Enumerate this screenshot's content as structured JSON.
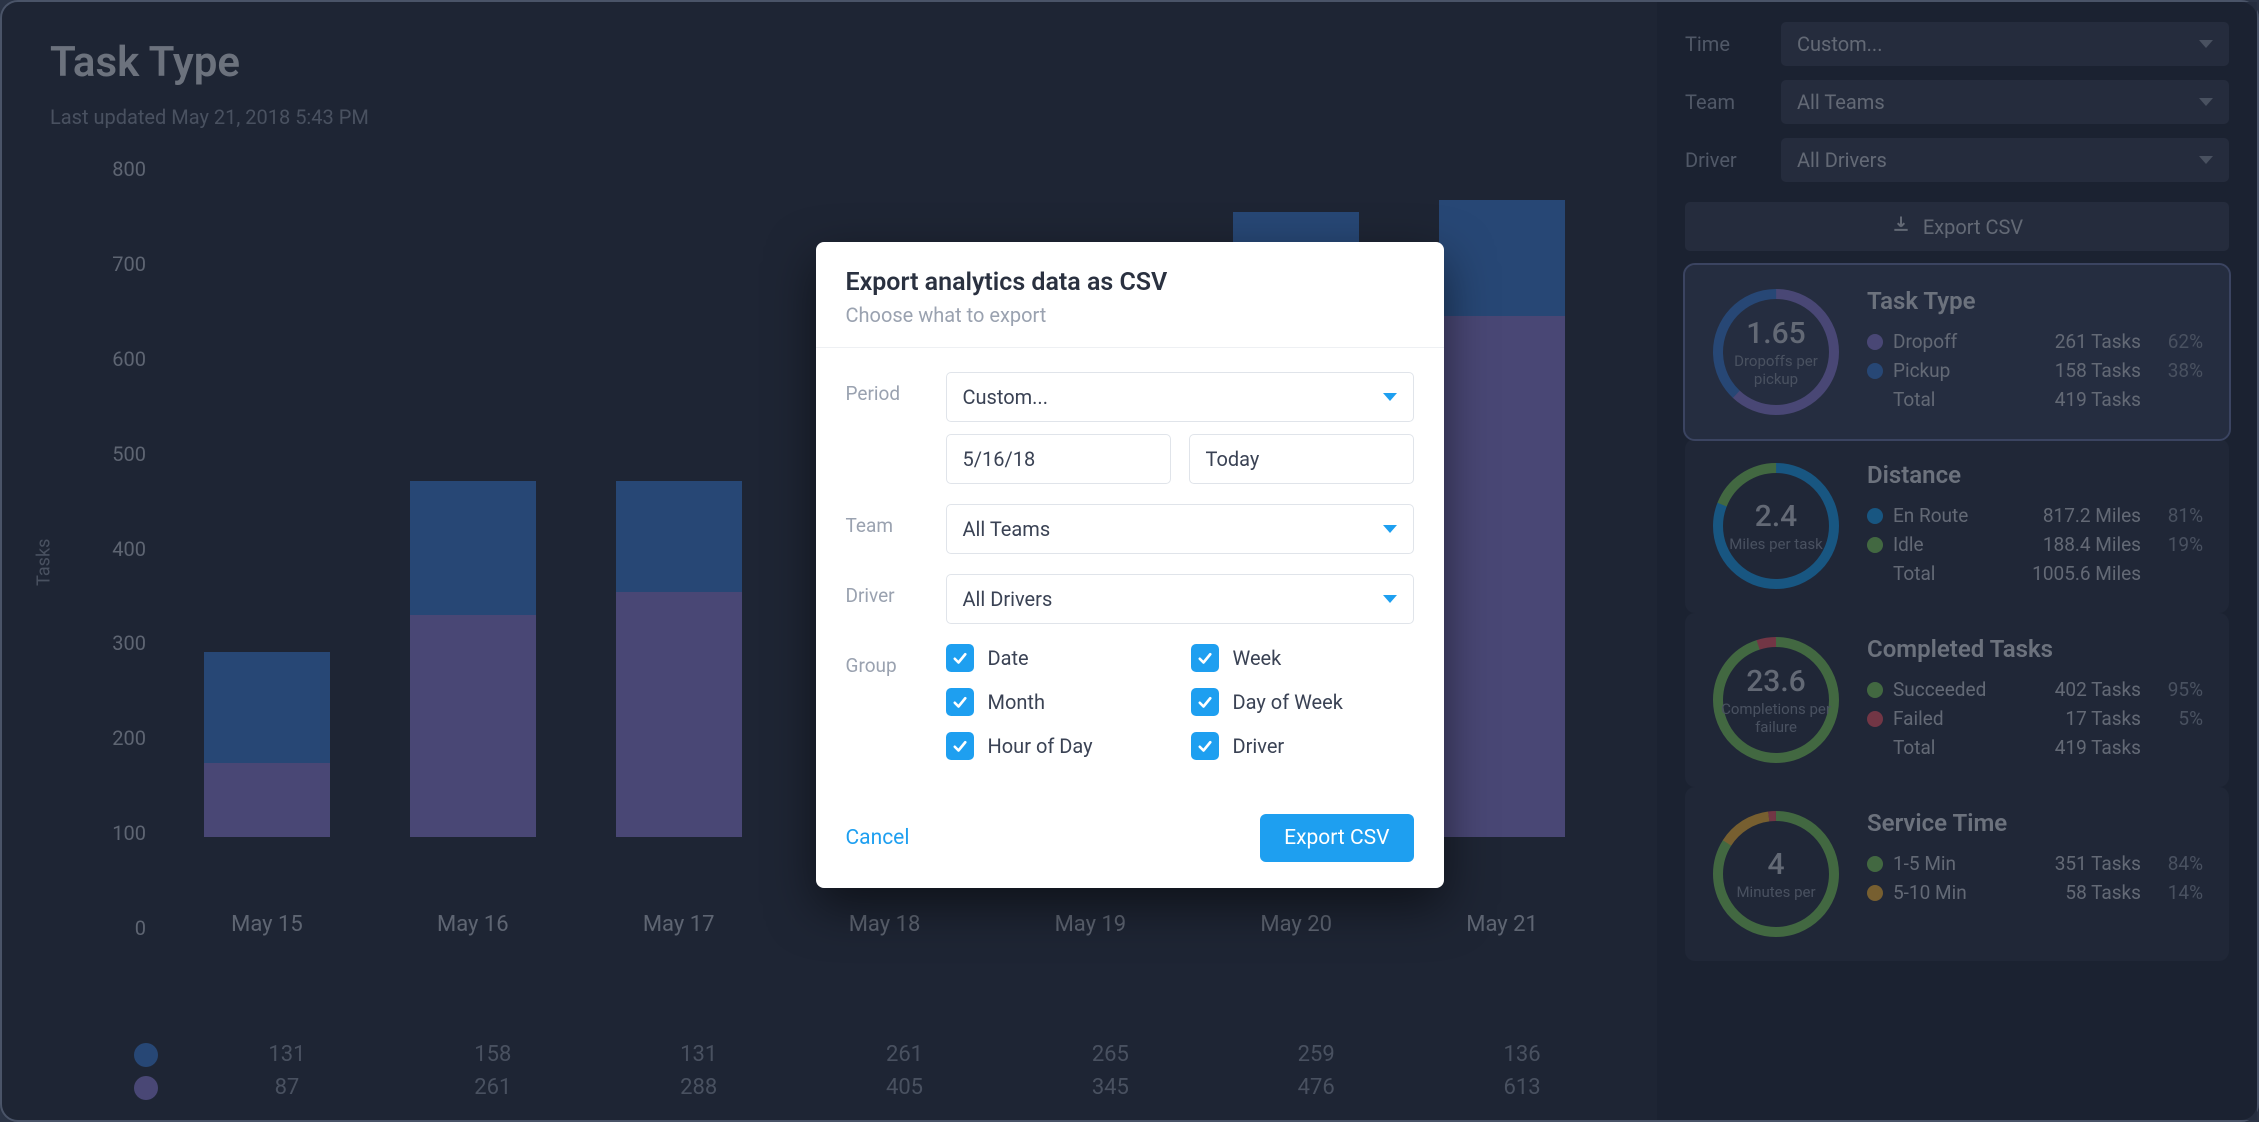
{
  "title": "Task Type",
  "updated": "Last updated May 21, 2018 5:43 PM",
  "chart_data": {
    "type": "bar",
    "ylabel": "Tasks",
    "ylim": [
      0,
      800
    ],
    "yticks": [
      800,
      700,
      600,
      500,
      400,
      300,
      200,
      100,
      0
    ],
    "categories": [
      "May 15",
      "May 16",
      "May 17",
      "May 18",
      "May 19",
      "May 20",
      "May 21"
    ],
    "series": [
      {
        "name": "Pickup",
        "color": "#3e7fd6",
        "values": [
          131,
          158,
          131,
          261,
          265,
          259,
          136
        ]
      },
      {
        "name": "Dropoff",
        "color": "#8b7fd6",
        "values": [
          87,
          261,
          288,
          405,
          345,
          476,
          613
        ]
      }
    ]
  },
  "sidebar": {
    "filters": {
      "time_label": "Time",
      "time_value": "Custom...",
      "team_label": "Team",
      "team_value": "All Teams",
      "driver_label": "Driver",
      "driver_value": "All Drivers"
    },
    "export_label": "Export CSV",
    "cards": [
      {
        "id": "task-type",
        "active": true,
        "metric": "1.65",
        "metric_sub": "Dropoffs per pickup",
        "title": "Task Type",
        "ring_segments": [
          {
            "color": "#8b7fd6",
            "pct": 62
          },
          {
            "color": "#3e7fd6",
            "pct": 38
          }
        ],
        "rows": [
          {
            "dot": "#8b7fd6",
            "name": "Dropoff",
            "val": "261 Tasks",
            "pct": "62%"
          },
          {
            "dot": "#3e7fd6",
            "name": "Pickup",
            "val": "158 Tasks",
            "pct": "38%"
          }
        ],
        "total_label": "Total",
        "total_val": "419 Tasks"
      },
      {
        "id": "distance",
        "active": false,
        "metric": "2.4",
        "metric_sub": "Miles per task",
        "title": "Distance",
        "ring_segments": [
          {
            "color": "#1e9ff0",
            "pct": 81
          },
          {
            "color": "#7bc862",
            "pct": 19
          }
        ],
        "rows": [
          {
            "dot": "#1e9ff0",
            "name": "En Route",
            "val": "817.2 Miles",
            "pct": "81%"
          },
          {
            "dot": "#7bc862",
            "name": "Idle",
            "val": "188.4 Miles",
            "pct": "19%"
          }
        ],
        "total_label": "Total",
        "total_val": "1005.6 Miles"
      },
      {
        "id": "completed",
        "active": false,
        "metric": "23.6",
        "metric_sub": "Completions per failure",
        "title": "Completed Tasks",
        "ring_segments": [
          {
            "color": "#7bc862",
            "pct": 95
          },
          {
            "color": "#e45a6c",
            "pct": 5
          }
        ],
        "rows": [
          {
            "dot": "#7bc862",
            "name": "Succeeded",
            "val": "402 Tasks",
            "pct": "95%"
          },
          {
            "dot": "#e45a6c",
            "name": "Failed",
            "val": "17 Tasks",
            "pct": "5%"
          }
        ],
        "total_label": "Total",
        "total_val": "419 Tasks"
      },
      {
        "id": "service-time",
        "active": false,
        "metric": "4",
        "metric_sub": "Minutes per",
        "title": "Service Time",
        "ring_segments": [
          {
            "color": "#7bc862",
            "pct": 84
          },
          {
            "color": "#f0b43c",
            "pct": 14
          },
          {
            "color": "#e45a6c",
            "pct": 2
          }
        ],
        "rows": [
          {
            "dot": "#7bc862",
            "name": "1-5 Min",
            "val": "351 Tasks",
            "pct": "84%"
          },
          {
            "dot": "#f0b43c",
            "name": "5-10 Min",
            "val": "58 Tasks",
            "pct": "14%"
          }
        ],
        "total_label": "",
        "total_val": ""
      }
    ]
  },
  "modal": {
    "title": "Export analytics data as CSV",
    "subtitle": "Choose what to export",
    "period_label": "Period",
    "period_value": "Custom...",
    "date_from": "5/16/18",
    "date_to": "Today",
    "team_label": "Team",
    "team_value": "All Teams",
    "driver_label": "Driver",
    "driver_value": "All Drivers",
    "group_label": "Group",
    "group_options": [
      {
        "label": "Date",
        "checked": true
      },
      {
        "label": "Week",
        "checked": true
      },
      {
        "label": "Month",
        "checked": true
      },
      {
        "label": "Day of Week",
        "checked": true
      },
      {
        "label": "Hour of Day",
        "checked": true
      },
      {
        "label": "Driver",
        "checked": true
      }
    ],
    "cancel": "Cancel",
    "submit": "Export CSV"
  }
}
